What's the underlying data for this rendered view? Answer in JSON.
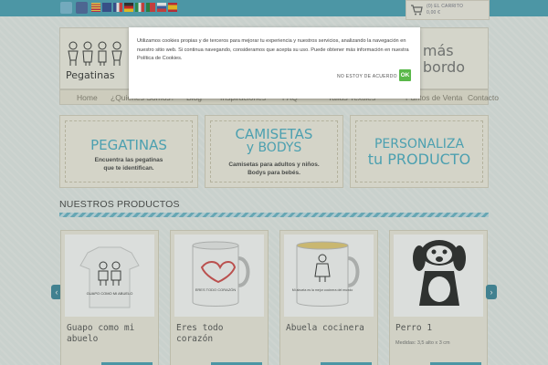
{
  "topbar": {
    "social": [
      "twitter-icon",
      "facebook-icon"
    ],
    "languages": [
      "Català",
      "English",
      "Français",
      "Deutsch",
      "Italiano",
      "Português",
      "Русский",
      "Español"
    ],
    "cart": {
      "line1": "(0) EL CARRITO",
      "line2": "0,00 €"
    }
  },
  "header": {
    "logo_text": "Pegatinas",
    "slogan_line1": "o más",
    "slogan_line2": "a bordo"
  },
  "nav": [
    "Home",
    "¿Quienes Somos?",
    "Blog",
    "Inspiraciones",
    "FAQ",
    "Tallas Textiles",
    "Puntos de Venta",
    "Contacto"
  ],
  "banners": [
    {
      "title": "PEGATINAS",
      "sub1": "Encuentra las pegatinas",
      "sub2": "que te identifican."
    },
    {
      "title1": "CAMISETAS",
      "title2": "y BODYS",
      "sub1": "Camisetas para adultos y niños.",
      "sub2": "Bodys para bebés."
    },
    {
      "title1": "PERSONALIZA",
      "title2": "tu PRODUCTO"
    }
  ],
  "section_title": "NUESTROS PRODUCTOS",
  "products": [
    {
      "name": "Guapo como mi abuelo",
      "image_text": "GUAPO COMO MI ABUELO"
    },
    {
      "name": "Eres todo corazón",
      "image_text": "ERES TODO CORAZÓN"
    },
    {
      "name": "Abuela cocinera",
      "image_text": "Mi abuela es la mejor cocinera del mundo"
    },
    {
      "name": "Perro 1",
      "extra": "Medidas: 3,5 alto x 3 cm"
    }
  ],
  "cookie": {
    "text": "Utilizamos cookies propias y de terceros para mejorar tu experiencia y nuestros servicios, analizando la navegación en nuestro sitio web. Si continua navegando, consideramos que acepta su uso. Puede obtener más información en nuestra Política de Cookies.",
    "decline_label": "NO ESTOY DE ACUERDO",
    "ok_label": "OK"
  },
  "colors": {
    "accent": "#3a9bb3",
    "ok_green": "#5ab84a",
    "paper": "#f5f1e3"
  }
}
